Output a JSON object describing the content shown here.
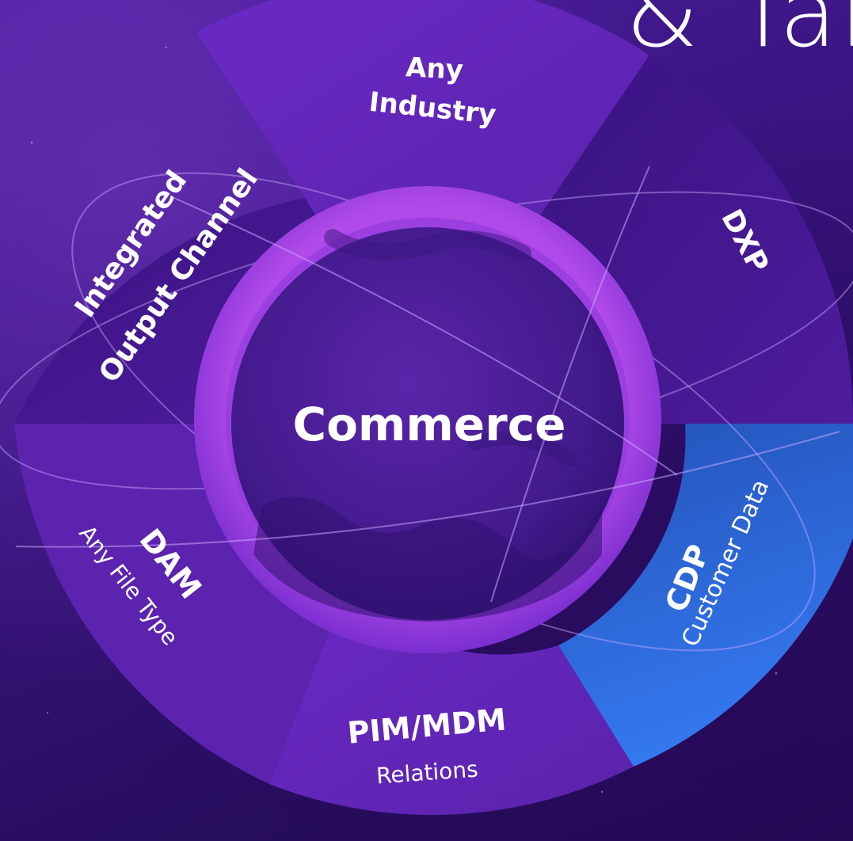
{
  "heading": "& Tar",
  "center": {
    "label": "Commerce"
  },
  "segments": {
    "any_industry": {
      "line1": "Any",
      "line2": "Industry"
    },
    "dxp": {
      "label": "DXP"
    },
    "cdp": {
      "label": "CDP",
      "sub": "Customer Data"
    },
    "pim_mdm": {
      "label": "PIM/MDM",
      "sub": "Relations"
    },
    "dam": {
      "label": "DAM",
      "sub": "Any File Type"
    },
    "integrated_output": {
      "line1": "Integrated",
      "line2": "Output Channel"
    }
  },
  "colors": {
    "background": "#3a1582",
    "segment_purple": "#6226b8",
    "segment_dark": "#3f1688",
    "cdp_blue": "#2f6ee6",
    "inner_ring": "#9a3fe0",
    "planet": "#4b1d94"
  }
}
